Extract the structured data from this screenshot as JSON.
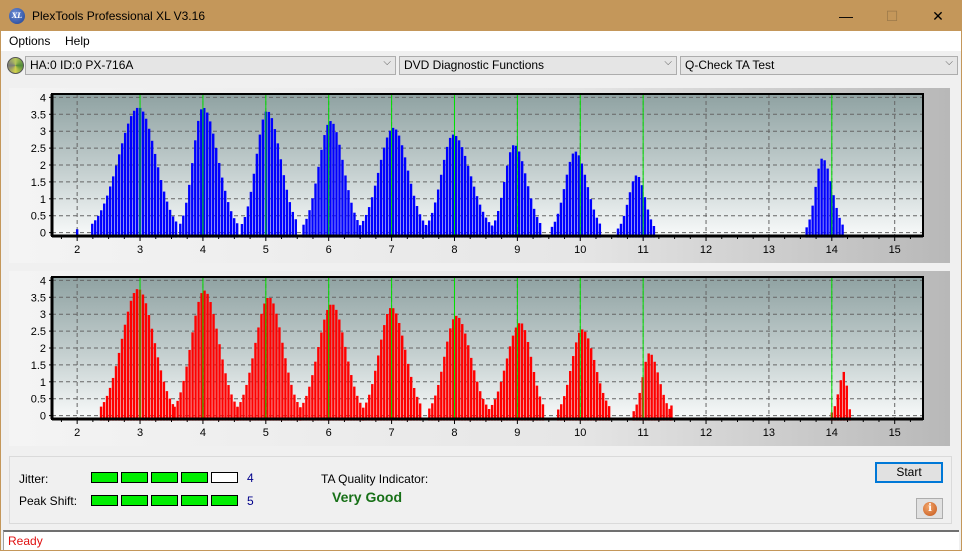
{
  "window": {
    "title": "PlexTools Professional XL V3.16",
    "app_icon_text": "XL",
    "controls": {
      "minimize": "—",
      "maximize": "☐",
      "close": "✕"
    }
  },
  "menu": {
    "items": [
      {
        "label": "Options"
      },
      {
        "label": "Help"
      }
    ]
  },
  "toolbar": {
    "drive_select": "HA:0 ID:0  PX-716A",
    "function_select": "DVD Diagnostic Functions",
    "test_select": "Q-Check TA Test",
    "chevron": "⌵"
  },
  "chart_data": [
    {
      "type": "bar",
      "name": "ta-histogram-land",
      "color": "#0000ff",
      "marker_color": "#00e000",
      "xlim": [
        1.6,
        15.45
      ],
      "ylim": [
        -0.1,
        4.1
      ],
      "yticks": [
        "0",
        "0.5",
        "1",
        "1.5",
        "2",
        "2.5",
        "3",
        "3.5",
        "4"
      ],
      "ytick_values": [
        0,
        0.5,
        1,
        1.5,
        2,
        2.5,
        3,
        3.5,
        4
      ],
      "xticks": [
        "2",
        "3",
        "4",
        "5",
        "6",
        "7",
        "8",
        "9",
        "10",
        "11",
        "12",
        "13",
        "14",
        "15"
      ],
      "xtick_values": [
        2,
        3,
        4,
        5,
        6,
        7,
        8,
        9,
        10,
        11,
        12,
        13,
        14,
        15
      ],
      "green_markers": [
        3,
        4,
        5,
        6,
        7,
        8,
        9,
        10,
        11,
        14
      ],
      "grid": true,
      "bin_width": 0.0476,
      "peaks": [
        {
          "center": 2.98,
          "height": 3.7,
          "start": 2.24,
          "end": 3.6
        },
        {
          "center": 4.0,
          "height": 3.7,
          "start": 3.64,
          "end": 4.55
        },
        {
          "center": 5.02,
          "height": 3.6,
          "start": 4.62,
          "end": 5.52
        },
        {
          "center": 6.03,
          "height": 3.3,
          "start": 5.6,
          "end": 6.5
        },
        {
          "center": 7.03,
          "height": 3.1,
          "start": 6.5,
          "end": 7.55
        },
        {
          "center": 7.98,
          "height": 2.9,
          "start": 7.55,
          "end": 8.6
        },
        {
          "center": 8.95,
          "height": 2.6,
          "start": 8.6,
          "end": 9.4
        },
        {
          "center": 9.92,
          "height": 2.4,
          "start": 9.55,
          "end": 10.35
        },
        {
          "center": 10.9,
          "height": 1.7,
          "start": 10.6,
          "end": 11.2
        },
        {
          "center": 13.85,
          "height": 2.2,
          "start": 13.6,
          "end": 14.2
        }
      ],
      "isolated_bars": [
        {
          "x": 2.0,
          "value": 0.1
        }
      ]
    },
    {
      "type": "bar",
      "name": "ta-histogram-pit",
      "color": "#ff0000",
      "marker_color": "#00e000",
      "xlim": [
        1.6,
        15.45
      ],
      "ylim": [
        -0.1,
        4.1
      ],
      "yticks": [
        "0",
        "0.5",
        "1",
        "1.5",
        "2",
        "2.5",
        "3",
        "3.5",
        "4"
      ],
      "ytick_values": [
        0,
        0.5,
        1,
        1.5,
        2,
        2.5,
        3,
        3.5,
        4
      ],
      "xticks": [
        "2",
        "3",
        "4",
        "5",
        "6",
        "7",
        "8",
        "9",
        "10",
        "11",
        "12",
        "13",
        "14",
        "15"
      ],
      "xtick_values": [
        2,
        3,
        4,
        5,
        6,
        7,
        8,
        9,
        10,
        11,
        12,
        13,
        14,
        15
      ],
      "green_markers": [
        3,
        4,
        5,
        6,
        7,
        8,
        9,
        10,
        11,
        14
      ],
      "grid": true,
      "bin_width": 0.0476,
      "peaks": [
        {
          "center": 2.97,
          "height": 3.75,
          "start": 2.38,
          "end": 3.55
        },
        {
          "center": 4.02,
          "height": 3.7,
          "start": 3.55,
          "end": 4.55
        },
        {
          "center": 5.05,
          "height": 3.5,
          "start": 4.55,
          "end": 5.55
        },
        {
          "center": 6.05,
          "height": 3.3,
          "start": 5.55,
          "end": 6.55
        },
        {
          "center": 7.0,
          "height": 3.2,
          "start": 6.55,
          "end": 7.5
        },
        {
          "center": 8.03,
          "height": 2.95,
          "start": 7.6,
          "end": 8.55
        },
        {
          "center": 9.05,
          "height": 2.75,
          "start": 8.55,
          "end": 9.45
        },
        {
          "center": 10.03,
          "height": 2.55,
          "start": 9.65,
          "end": 10.5
        },
        {
          "center": 11.1,
          "height": 1.85,
          "start": 10.85,
          "end": 11.45
        },
        {
          "center": 14.2,
          "height": 1.3,
          "start": 14.0,
          "end": 14.3
        }
      ],
      "isolated_bars": [
        {
          "x": 11.45,
          "value": 0.3
        }
      ]
    }
  ],
  "metrics": {
    "jitter": {
      "label": "Jitter:",
      "value": "4",
      "level": 4,
      "max": 5
    },
    "peak_shift": {
      "label": "Peak Shift:",
      "value": "5",
      "level": 5,
      "max": 5
    }
  },
  "quality": {
    "label": "TA Quality Indicator:",
    "value": "Very Good"
  },
  "buttons": {
    "start": "Start",
    "info": "i"
  },
  "status": {
    "text": "Ready"
  }
}
